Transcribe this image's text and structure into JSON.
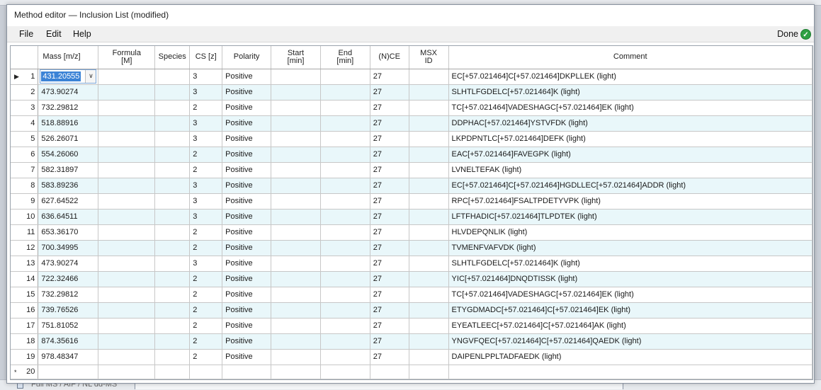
{
  "window": {
    "title": "Method editor — Inclusion List (modified)"
  },
  "menu": {
    "file": "File",
    "edit": "Edit",
    "help": "Help",
    "done": "Done"
  },
  "background": {
    "label": "Full MS / AIF / NL dd-MS"
  },
  "columns": [
    "Mass [m/z]",
    "Formula\n[M]",
    "Species",
    "CS [z]",
    "Polarity",
    "Start\n[min]",
    "End\n[min]",
    "(N)CE",
    "MSX\nID",
    "Comment"
  ],
  "rows": [
    {
      "num": "1",
      "mass": "431.20555",
      "cs": "3",
      "polarity": "Positive",
      "nce": "27",
      "comment": "EC[+57.021464]C[+57.021464]DKPLLEK (light)"
    },
    {
      "num": "2",
      "mass": "473.90274",
      "cs": "3",
      "polarity": "Positive",
      "nce": "27",
      "comment": "SLHTLFGDELC[+57.021464]K (light)"
    },
    {
      "num": "3",
      "mass": "732.29812",
      "cs": "2",
      "polarity": "Positive",
      "nce": "27",
      "comment": "TC[+57.021464]VADESHAGC[+57.021464]EK (light)"
    },
    {
      "num": "4",
      "mass": "518.88916",
      "cs": "3",
      "polarity": "Positive",
      "nce": "27",
      "comment": "DDPHAC[+57.021464]YSTVFDK (light)"
    },
    {
      "num": "5",
      "mass": "526.26071",
      "cs": "3",
      "polarity": "Positive",
      "nce": "27",
      "comment": "LKPDPNTLC[+57.021464]DEFK (light)"
    },
    {
      "num": "6",
      "mass": "554.26060",
      "cs": "2",
      "polarity": "Positive",
      "nce": "27",
      "comment": "EAC[+57.021464]FAVEGPK (light)"
    },
    {
      "num": "7",
      "mass": "582.31897",
      "cs": "2",
      "polarity": "Positive",
      "nce": "27",
      "comment": "LVNELTEFAK (light)"
    },
    {
      "num": "8",
      "mass": "583.89236",
      "cs": "3",
      "polarity": "Positive",
      "nce": "27",
      "comment": "EC[+57.021464]C[+57.021464]HGDLLEC[+57.021464]ADDR (light)"
    },
    {
      "num": "9",
      "mass": "627.64522",
      "cs": "3",
      "polarity": "Positive",
      "nce": "27",
      "comment": "RPC[+57.021464]FSALTPDETYVPK (light)"
    },
    {
      "num": "10",
      "mass": "636.64511",
      "cs": "3",
      "polarity": "Positive",
      "nce": "27",
      "comment": "LFTFHADIC[+57.021464]TLPDTEK (light)"
    },
    {
      "num": "11",
      "mass": "653.36170",
      "cs": "2",
      "polarity": "Positive",
      "nce": "27",
      "comment": "HLVDEPQNLIK (light)"
    },
    {
      "num": "12",
      "mass": "700.34995",
      "cs": "2",
      "polarity": "Positive",
      "nce": "27",
      "comment": "TVMENFVAFVDK (light)"
    },
    {
      "num": "13",
      "mass": "473.90274",
      "cs": "3",
      "polarity": "Positive",
      "nce": "27",
      "comment": "SLHTLFGDELC[+57.021464]K (light)"
    },
    {
      "num": "14",
      "mass": "722.32466",
      "cs": "2",
      "polarity": "Positive",
      "nce": "27",
      "comment": "YIC[+57.021464]DNQDTISSK (light)"
    },
    {
      "num": "15",
      "mass": "732.29812",
      "cs": "2",
      "polarity": "Positive",
      "nce": "27",
      "comment": "TC[+57.021464]VADESHAGC[+57.021464]EK (light)"
    },
    {
      "num": "16",
      "mass": "739.76526",
      "cs": "2",
      "polarity": "Positive",
      "nce": "27",
      "comment": "ETYGDMADC[+57.021464]C[+57.021464]EK (light)"
    },
    {
      "num": "17",
      "mass": "751.81052",
      "cs": "2",
      "polarity": "Positive",
      "nce": "27",
      "comment": "EYEATLEEC[+57.021464]C[+57.021464]AK (light)"
    },
    {
      "num": "18",
      "mass": "874.35616",
      "cs": "2",
      "polarity": "Positive",
      "nce": "27",
      "comment": "YNGVFQEC[+57.021464]C[+57.021464]QAEDK (light)"
    },
    {
      "num": "19",
      "mass": "978.48347",
      "cs": "2",
      "polarity": "Positive",
      "nce": "27",
      "comment": "DAIPENLPPLTADFAEDK (light)"
    }
  ],
  "new_row": {
    "num": "20",
    "marker": "*"
  },
  "current_row_marker": "▶",
  "colors": {
    "selection": "#3b83d6",
    "alt_row": "#e9f7fa",
    "done_ok": "#2ea043"
  }
}
